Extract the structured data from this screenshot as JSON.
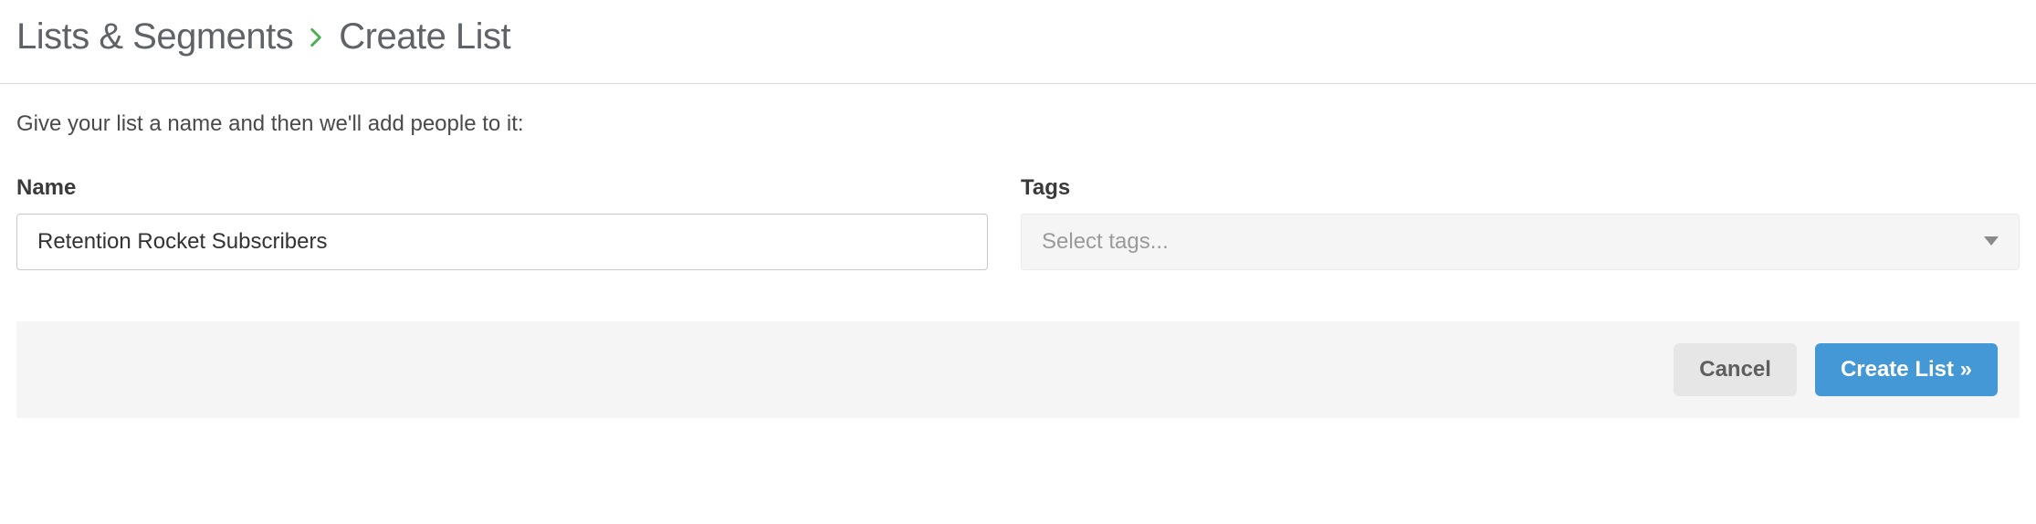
{
  "breadcrumb": {
    "parent": "Lists & Segments",
    "current": "Create List"
  },
  "instruction": "Give your list a name and then we'll add people to it:",
  "form": {
    "name": {
      "label": "Name",
      "value": "Retention Rocket Subscribers"
    },
    "tags": {
      "label": "Tags",
      "placeholder": "Select tags..."
    }
  },
  "footer": {
    "cancel": "Cancel",
    "submit": "Create List »"
  }
}
